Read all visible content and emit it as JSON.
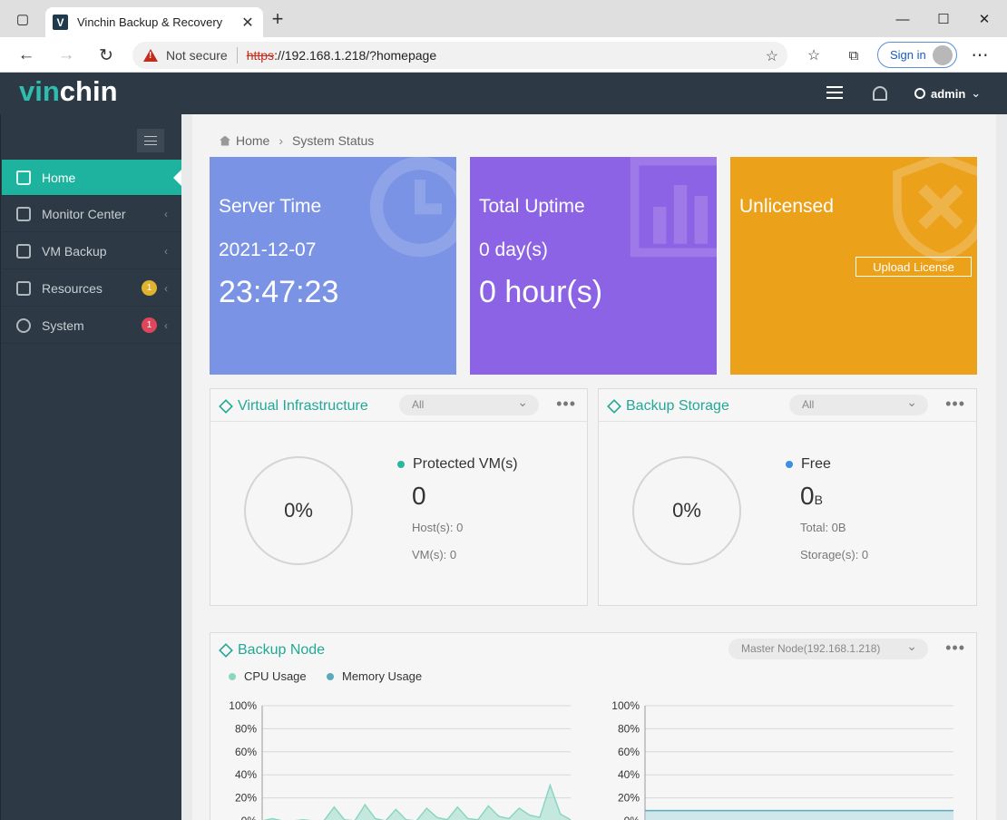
{
  "browser": {
    "tab_title": "Vinchin Backup & Recovery",
    "tab_favicon": "V",
    "not_secure": "Not secure",
    "url_protocol": "https",
    "url_rest": "://192.168.1.218/?homepage",
    "signin_label": "Sign in"
  },
  "app": {
    "logo_accent": "vin",
    "logo_rest": "chin",
    "user": "admin"
  },
  "sidebar": {
    "items": [
      {
        "label": "Home",
        "active": true
      },
      {
        "label": "Monitor Center"
      },
      {
        "label": "VM Backup"
      },
      {
        "label": "Resources",
        "badge": "1",
        "badge_color": "#e0b22e"
      },
      {
        "label": "System",
        "badge": "1",
        "badge_color": "#e0465a"
      }
    ]
  },
  "breadcrumb": {
    "home": "Home",
    "current": "System Status"
  },
  "cards": {
    "server_time": {
      "title": "Server Time",
      "date": "2021-12-07",
      "time": "23:47:23",
      "color": "#7b93e4"
    },
    "uptime": {
      "title": "Total Uptime",
      "days": "0 day(s)",
      "hours": "0 hour(s)",
      "color": "#8c63e4"
    },
    "license": {
      "title": "Unlicensed",
      "button": "Upload License",
      "color": "#eca11b"
    }
  },
  "virtual_infrastructure": {
    "title": "Virtual Infrastructure",
    "filter": "All",
    "more": "•••",
    "percent": "0%",
    "label": "Protected VM(s)",
    "value": "0",
    "hosts": "Host(s): 0",
    "vms": "VM(s): 0",
    "dot_color": "#2db69f"
  },
  "backup_storage": {
    "title": "Backup Storage",
    "filter": "All",
    "more": "•••",
    "percent": "0%",
    "label": "Free",
    "value": "0",
    "unit": "B",
    "total": "Total: 0B",
    "storages": "Storage(s): 0",
    "dot_color": "#3a8ee6"
  },
  "backup_node": {
    "title": "Backup Node",
    "node_select": "Master Node(192.168.1.218)",
    "more": "•••",
    "legend_cpu": "CPU Usage",
    "legend_mem": "Memory Usage",
    "cpu_color": "#8ad6c2",
    "mem_color": "#5aaabb"
  },
  "chart_data": [
    {
      "type": "area",
      "title": "",
      "series": [
        {
          "name": "CPU Usage",
          "values": [
            0,
            2,
            0,
            0,
            1,
            0,
            0,
            12,
            1,
            0,
            14,
            2,
            0,
            10,
            1,
            0,
            11,
            3,
            1,
            12,
            2,
            1,
            13,
            4,
            2,
            11,
            5,
            3,
            31,
            6,
            1
          ]
        }
      ],
      "yticks": [
        "0%",
        "20%",
        "40%",
        "60%",
        "80%",
        "100%"
      ],
      "ylim": [
        0,
        100
      ]
    },
    {
      "type": "area",
      "title": "",
      "series": [
        {
          "name": "Memory Usage",
          "values": [
            9,
            9,
            9,
            9,
            9,
            9,
            9,
            9,
            9,
            9,
            9,
            9,
            9,
            9,
            9,
            9
          ]
        }
      ],
      "yticks": [
        "0%",
        "20%",
        "40%",
        "60%",
        "80%",
        "100%"
      ],
      "ylim": [
        0,
        100
      ]
    }
  ]
}
